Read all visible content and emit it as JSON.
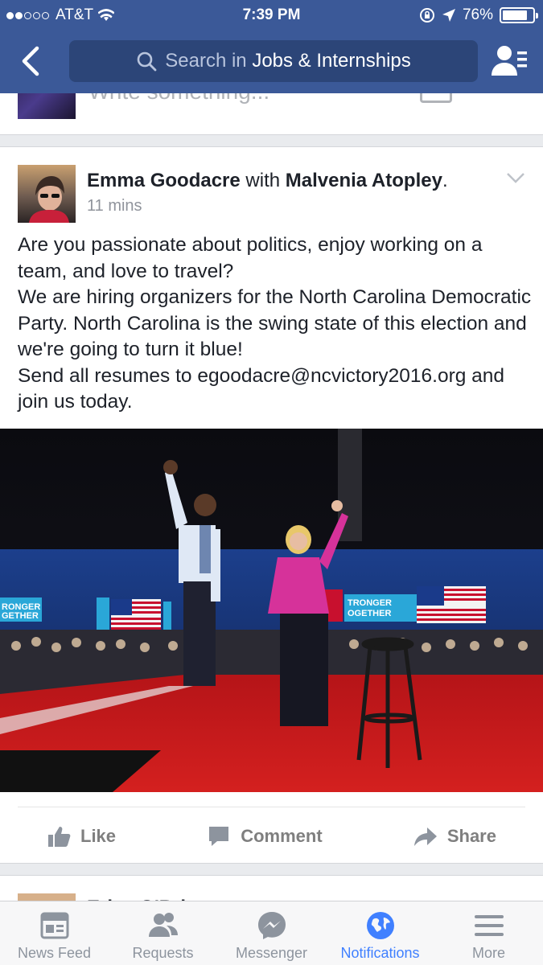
{
  "status": {
    "carrier": "AT&T",
    "time": "7:39 PM",
    "battery": "76%"
  },
  "search": {
    "prefix": "Search in",
    "group": "Jobs & Internships"
  },
  "prev_post": {
    "write_placeholder": "Write something..."
  },
  "post": {
    "author": "Emma Goodacre",
    "with": "with",
    "tagged": "Malvenia Atopley",
    "period": ".",
    "time": "11 mins",
    "body": "Are you passionate about politics, enjoy working on a team, and love to travel?\nWe are hiring organizers for the North Carolina Democratic Party. North Carolina is the swing state of this election and we're going to turn it blue!\nSend all resumes to egoodacre@ncvictory2016.org and join us today.",
    "photo_banner_left": "RONGER\nGETHER",
    "photo_banner_right": "TRONGER\nOGETHER",
    "actions": {
      "like": "Like",
      "comment": "Comment",
      "share": "Share"
    }
  },
  "next_post": {
    "name": "Erica O'Bri..."
  },
  "tabs": [
    {
      "label": "News Feed",
      "icon": "news-feed-icon"
    },
    {
      "label": "Requests",
      "icon": "requests-icon"
    },
    {
      "label": "Messenger",
      "icon": "messenger-icon"
    },
    {
      "label": "Notifications",
      "icon": "globe-icon",
      "active": true
    },
    {
      "label": "More",
      "icon": "menu-icon"
    }
  ],
  "colors": {
    "brand": "#3b5998",
    "active_tab": "#4080ff"
  }
}
